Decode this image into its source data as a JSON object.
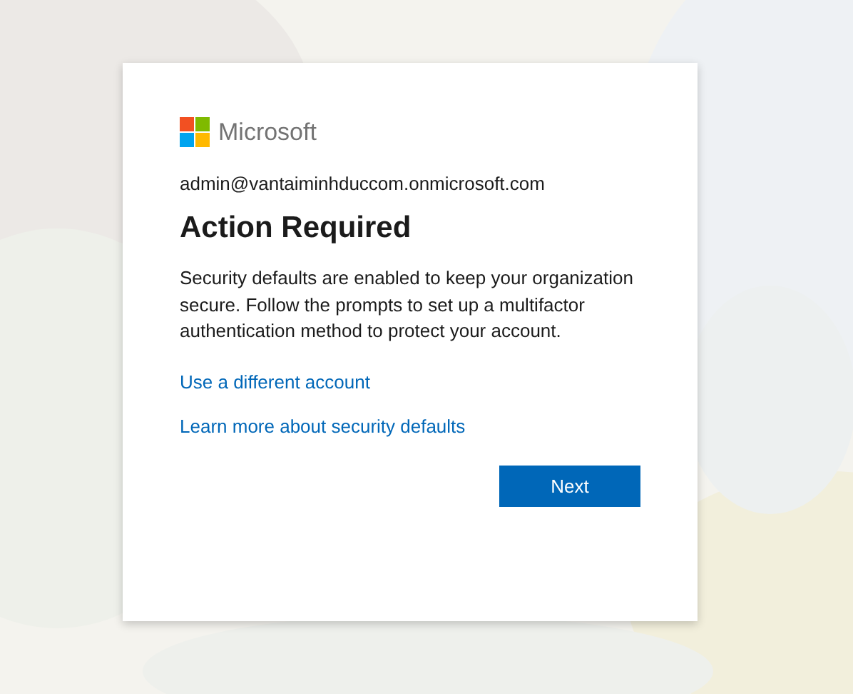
{
  "brand": "Microsoft",
  "account": "admin@vantaiminhduccom.onmicrosoft.com",
  "title": "Action Required",
  "message": "Security defaults are enabled to keep your organization secure. Follow the prompts to set up a multifactor authentication method to protect your account.",
  "links": [
    "Use a different account",
    "Learn more about security defaults"
  ],
  "button": "Next"
}
